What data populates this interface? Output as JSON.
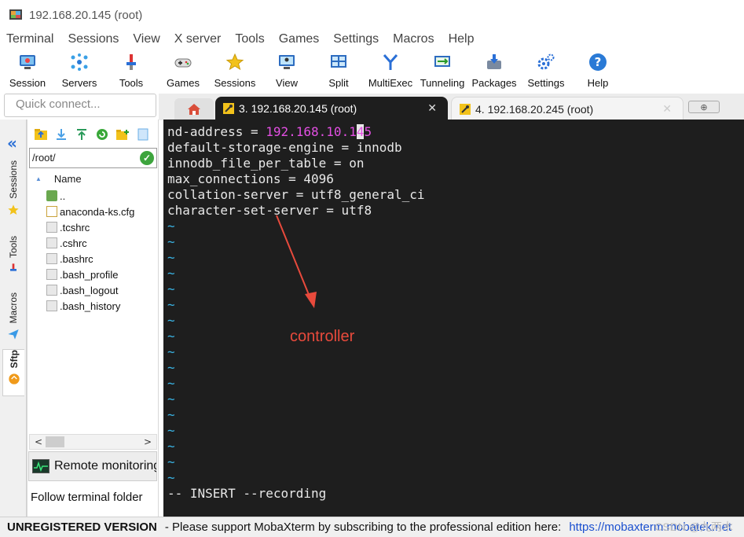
{
  "window": {
    "title": "192.168.20.145 (root)"
  },
  "menu": [
    "Terminal",
    "Sessions",
    "View",
    "X server",
    "Tools",
    "Games",
    "Settings",
    "Macros",
    "Help"
  ],
  "toolbar": [
    {
      "label": "Session",
      "icon": "session-icon"
    },
    {
      "label": "Servers",
      "icon": "servers-icon"
    },
    {
      "label": "Tools",
      "icon": "tools-icon"
    },
    {
      "label": "Games",
      "icon": "games-icon"
    },
    {
      "label": "Sessions",
      "icon": "star-icon"
    },
    {
      "label": "View",
      "icon": "view-icon"
    },
    {
      "label": "Split",
      "icon": "split-icon"
    },
    {
      "label": "MultiExec",
      "icon": "multiexec-icon"
    },
    {
      "label": "Tunneling",
      "icon": "tunneling-icon"
    },
    {
      "label": "Packages",
      "icon": "packages-icon"
    },
    {
      "label": "Settings",
      "icon": "settings-icon"
    },
    {
      "label": "Help",
      "icon": "help-icon"
    }
  ],
  "quick_connect": {
    "placeholder": "Quick connect..."
  },
  "tabs": [
    {
      "label": "3. 192.168.20.145 (root)",
      "active": true
    },
    {
      "label": "4. 192.168.20.245 (root)",
      "active": false
    }
  ],
  "tab_close": "✕",
  "new_tab": "⊕",
  "side_tabs": [
    "Sessions",
    "Tools",
    "Macros",
    "Sftp"
  ],
  "sftp": {
    "path": "/root/",
    "column": "Name",
    "files": [
      "..",
      "anaconda-ks.cfg",
      ".tcshrc",
      ".cshrc",
      ".bashrc",
      ".bash_profile",
      ".bash_logout",
      ".bash_history"
    ],
    "remote_monitoring": "Remote monitoring",
    "follow_folder": "Follow terminal folder"
  },
  "terminal": {
    "line1_prefix": "nd-address = ",
    "line1_ip_a": "192.168.10.1",
    "line1_cursor": "4",
    "line1_ip_b": "5",
    "lines": [
      "default-storage-engine = innodb",
      "innodb_file_per_table = on",
      "max_connections = 4096",
      "collation-server = utf8_general_ci",
      "character-set-server = utf8"
    ],
    "tilde": "~",
    "tilde_count": 17,
    "mode_line": "-- INSERT --recording",
    "annotation": "controller"
  },
  "colors": {
    "terminal_bg": "#1e1e1e",
    "ip_color": "#e34fe3",
    "tilde_color": "#3ab5e6",
    "annotation_color": "#e84a3c"
  },
  "status": {
    "unregistered": "UNREGISTERED VERSION",
    "message": "-  Please support MobaXterm by subscribing to the professional edition here:",
    "link": "https://mobaxterm.mobatek.net",
    "watermark": "CSDN @九两木"
  }
}
